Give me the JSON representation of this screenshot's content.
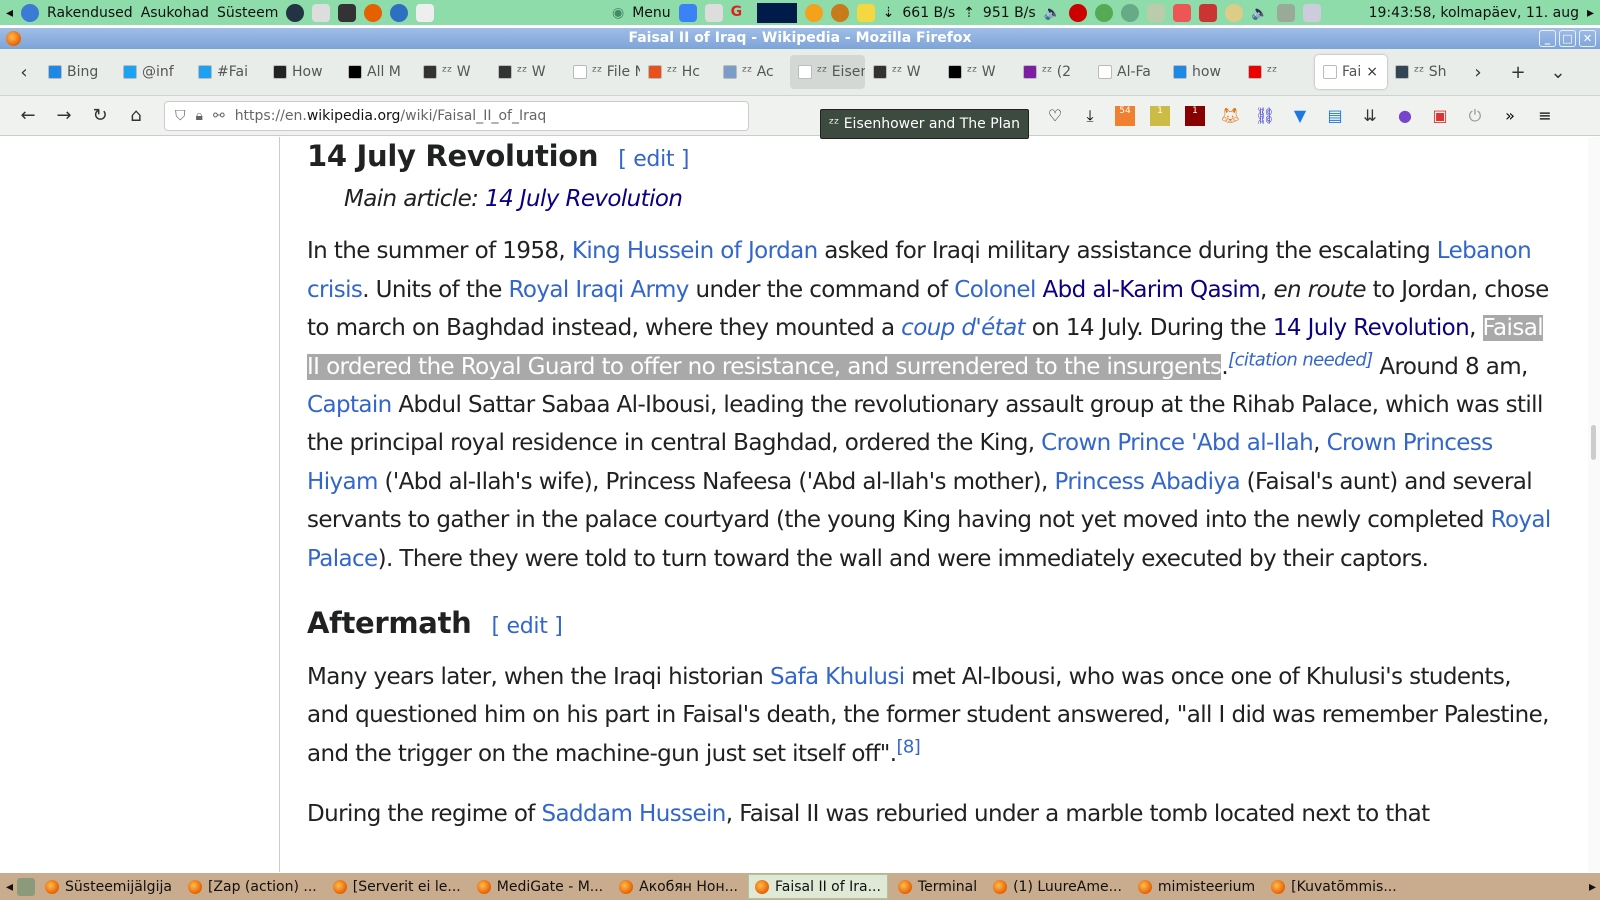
{
  "panel": {
    "menus": [
      "Rakendused",
      "Asukohad",
      "Süsteem"
    ],
    "menu_label": "Menu",
    "net_down": "661 B/s",
    "net_up": "951 B/s",
    "clock": "19:43:58, kolmapäev, 11. aug"
  },
  "window": {
    "title": "Faisal II of Iraq - Wikipedia - Mozilla Firefox"
  },
  "tabs": [
    {
      "label": "Bing",
      "color": "#1e88e5"
    },
    {
      "label": "@inf",
      "color": "#1da1f2"
    },
    {
      "label": "#Fai",
      "color": "#1da1f2"
    },
    {
      "label": "How",
      "color": "#222"
    },
    {
      "label": "All M",
      "color": "#000"
    },
    {
      "label": "ᶻᶻ W",
      "color": "#333"
    },
    {
      "label": "ᶻᶻ W",
      "color": "#333"
    },
    {
      "label": "ᶻᶻ File N",
      "color": "#fff"
    },
    {
      "label": "ᶻᶻ Hc",
      "color": "#e8501e"
    },
    {
      "label": "ᶻᶻ Ac",
      "color": "#7a9cc6"
    },
    {
      "label": "ᶻᶻ Eisen",
      "color": "#fff"
    },
    {
      "label": "ᶻᶻ W",
      "color": "#333"
    },
    {
      "label": "ᶻᶻ W",
      "color": "#000"
    },
    {
      "label": "ᶻᶻ (2",
      "color": "#7b1fa2"
    },
    {
      "label": "Al-Fa",
      "color": "#fff"
    },
    {
      "label": "how",
      "color": "#1e88e5"
    },
    {
      "label": "ᶻᶻ",
      "color": "#e00"
    },
    {
      "label": "Fai",
      "color": "#fff"
    },
    {
      "label": "ᶻᶻ Sh",
      "color": "#345"
    }
  ],
  "active_tab_index": 17,
  "hover_tab_index": 10,
  "nav": {
    "url_prefix": "https://en.",
    "url_domain": "wikipedia.org",
    "url_path": "/wiki/Faisal_II_of_Iraq",
    "ext_badge_1": "54",
    "ext_badge_2": "1",
    "ext_badge_3": "1"
  },
  "tooltip": "ᶻᶻ Eisenhower and The Plan",
  "article": {
    "section1": {
      "title": "14 July Revolution",
      "edit": "[ edit ]",
      "hatnote_prefix": "Main article: ",
      "hatnote_link": "14 July Revolution"
    },
    "para1": [
      {
        "t": "In the summer of 1958, "
      },
      {
        "t": "King Hussein of Jordan",
        "l": 1
      },
      {
        "t": " asked for Iraqi military assistance during the escalating "
      },
      {
        "t": "Lebanon crisis",
        "l": 1
      },
      {
        "t": ". Units of the "
      },
      {
        "t": "Royal Iraqi Army",
        "l": 1
      },
      {
        "t": " under the command of "
      },
      {
        "t": "Colonel",
        "l": 1
      },
      {
        "t": " "
      },
      {
        "t": "Abd al-Karim Qasim",
        "l": 1,
        "v": 1
      },
      {
        "t": ", "
      },
      {
        "t": "en route",
        "i": 1
      },
      {
        "t": " to Jordan, chose to march on Baghdad instead, where they mounted a "
      },
      {
        "t": "coup d'état",
        "l": 1,
        "i": 1
      },
      {
        "t": " on 14 July. During the "
      },
      {
        "t": "14 July Revolution",
        "l": 1,
        "v": 1
      },
      {
        "t": ", "
      },
      {
        "t": "Faisal II ordered the Royal Guard to offer no resistance, and surrendered to the insurgents",
        "s": 1
      },
      {
        "t": "."
      },
      {
        "t": "[citation needed]",
        "sup": 1
      },
      {
        "t": " Around 8 am, "
      },
      {
        "t": "Captain",
        "l": 1
      },
      {
        "t": " Abdul Sattar Sabaa Al-Ibousi, leading the revolutionary assault group at the Rihab Palace, which was still the principal royal residence in central Baghdad, ordered the King, "
      },
      {
        "t": "Crown Prince 'Abd al-Ilah",
        "l": 1
      },
      {
        "t": ", "
      },
      {
        "t": "Crown Princess Hiyam",
        "l": 1
      },
      {
        "t": " ('Abd al-Ilah's wife), Princess Nafeesa ('Abd al-Ilah's mother), "
      },
      {
        "t": "Princess Abadiya",
        "l": 1
      },
      {
        "t": " (Faisal's aunt) and several servants to gather in the palace courtyard (the young King having not yet moved into the newly completed "
      },
      {
        "t": "Royal Palace",
        "l": 1
      },
      {
        "t": "). There they were told to turn toward the wall and were immediately executed by their captors."
      }
    ],
    "section2": {
      "title": "Aftermath",
      "edit": "[ edit ]"
    },
    "para2": [
      {
        "t": "Many years later, when the Iraqi historian "
      },
      {
        "t": "Safa Khulusi",
        "l": 1
      },
      {
        "t": " met Al-Ibousi, who was once one of Khulusi's students, and questioned him on his part in Faisal's death, the former student answered, \"all I did was remember Palestine, and the trigger on the machine-gun just set itself off\"."
      },
      {
        "t": "[8]",
        "sup": 1,
        "l": 1
      }
    ],
    "para3": [
      {
        "t": "During the regime of "
      },
      {
        "t": "Saddam Hussein",
        "l": 1
      },
      {
        "t": ", Faisal II was reburied under a marble tomb located next to that"
      }
    ]
  },
  "taskbar": [
    {
      "label": "Süsteemijälgija"
    },
    {
      "label": "[Zap (action) ..."
    },
    {
      "label": "[Serverit ei le..."
    },
    {
      "label": "MediGate - M..."
    },
    {
      "label": "Акобян Нон..."
    },
    {
      "label": "Faisal II of Ira...",
      "active": true
    },
    {
      "label": "Terminal"
    },
    {
      "label": "(1) LuureAme..."
    },
    {
      "label": "mimisteerium"
    },
    {
      "label": "[Kuvatõmmis..."
    }
  ]
}
